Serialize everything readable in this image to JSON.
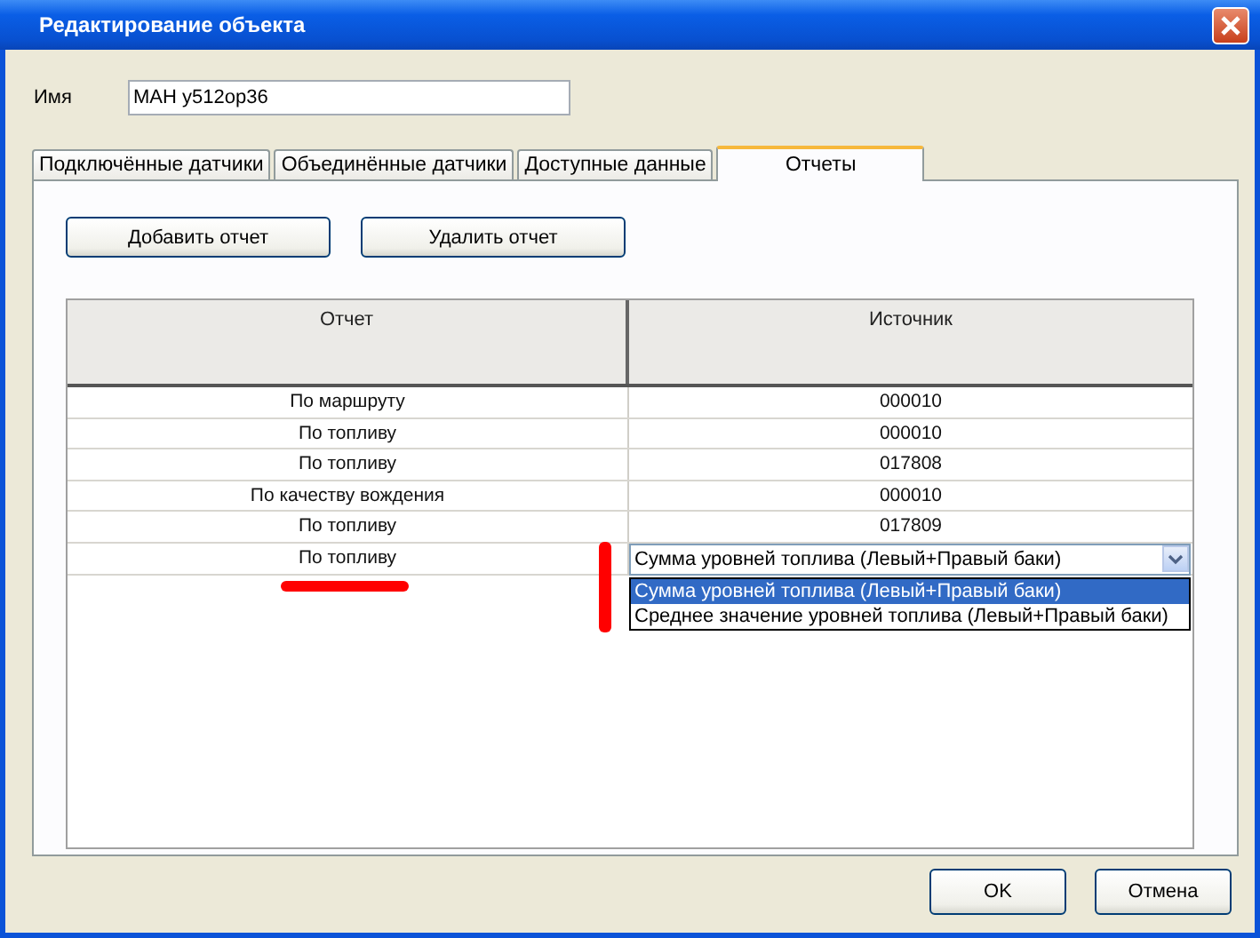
{
  "window": {
    "title": "Редактирование объекта"
  },
  "name_field": {
    "label": "Имя",
    "value": "МАН у512ор36"
  },
  "tabs": [
    {
      "label": "Подключённые датчики",
      "selected": false
    },
    {
      "label": "Объединённые датчики",
      "selected": false
    },
    {
      "label": "Доступные данные",
      "selected": false
    },
    {
      "label": "Отчеты",
      "selected": true
    }
  ],
  "toolbar_buttons": [
    "Добавить отчет",
    "Удалить отчет"
  ],
  "table": {
    "columns": [
      "Отчет",
      "Источник"
    ],
    "rows": [
      {
        "kind": "text",
        "report": "По маршруту",
        "source": "000010"
      },
      {
        "kind": "text",
        "report": "По топливу",
        "source": "000010"
      },
      {
        "kind": "text",
        "report": "По топливу",
        "source": "017808"
      },
      {
        "kind": "text",
        "report": "По качеству вождения",
        "source": "000010"
      },
      {
        "kind": "text",
        "report": "По топливу",
        "source": "017809"
      },
      {
        "kind": "dropdown",
        "report": "По топливу",
        "source": "Сумма уровней топлива (Левый+Правый баки)",
        "expanded": true,
        "options": [
          {
            "label": "Сумма уровней топлива (Левый+Правый баки)",
            "selected": true
          },
          {
            "label": "Среднее значение уровней топлива (Левый+Правый баки)",
            "selected": false
          }
        ]
      }
    ]
  },
  "buttons": [
    "OK",
    "Отмена"
  ]
}
